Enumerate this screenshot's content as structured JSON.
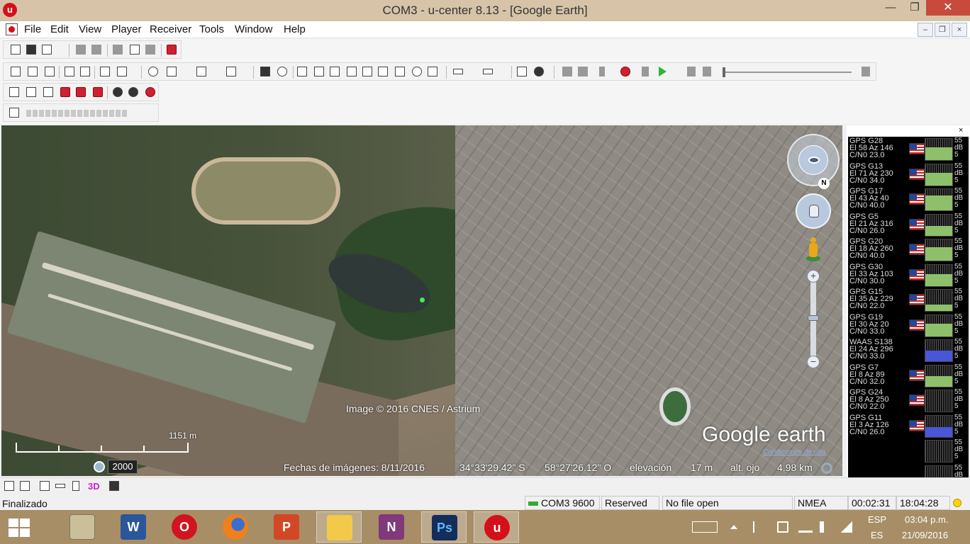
{
  "window": {
    "title": "COM3 - u-center 8.13 - [Google Earth]",
    "app_icon_letter": "u",
    "minimize_glyph": "—",
    "restore_glyph": "❐",
    "close_glyph": "✕"
  },
  "menu": {
    "items": [
      "File",
      "Edit",
      "View",
      "Player",
      "Receiver",
      "Tools",
      "Window",
      "Help"
    ],
    "mdi_min": "–",
    "mdi_restore": "❐",
    "mdi_close": "×"
  },
  "map": {
    "attribution": "Image © 2016 CNES / Astrium",
    "logo_google": "Google",
    "logo_earth": "earth",
    "terms": "Condiciones de uso",
    "scale_label": "1151 m",
    "history_year": "2000",
    "imagery_date": "Fechas de imágenes: 8/11/2016",
    "latitude": "34°33'29.42\" S",
    "longitude": "58°27'26.12\" O",
    "elevation_label": "elevación",
    "elevation_value": "17 m",
    "eye_alt_label": "alt. ojo",
    "eye_alt_value": "4.98 km",
    "north_label": "N",
    "zoom_in": "+",
    "zoom_out": "−"
  },
  "satellites": [
    {
      "name": "GPS G28",
      "el": "El 58 Az 146",
      "cn0": "C/N0 23.0",
      "level": 0.6,
      "flag": "us-flag-icon",
      "color": "#8ec06c"
    },
    {
      "name": "GPS G13",
      "el": "El 71 Az 230",
      "cn0": "C/N0 34.0",
      "level": 0.6,
      "flag": "us-flag-icon",
      "color": "#8ec06c"
    },
    {
      "name": "GPS G17",
      "el": "El 43 Az 40",
      "cn0": "C/N0 40.0",
      "level": 0.7,
      "flag": "us-flag-icon",
      "color": "#8ec06c"
    },
    {
      "name": "GPS G5",
      "el": "El 21 Az 316",
      "cn0": "C/N0 26.0",
      "level": 0.45,
      "flag": "us-flag-icon",
      "color": "#8ec06c"
    },
    {
      "name": "GPS G20",
      "el": "El 18 Az 260",
      "cn0": "C/N0 40.0",
      "level": 0.65,
      "flag": "us-flag-icon",
      "color": "#8ec06c"
    },
    {
      "name": "GPS G30",
      "el": "El 33 Az 103",
      "cn0": "C/N0 30.0",
      "level": 0.55,
      "flag": "us-flag-icon",
      "color": "#8ec06c"
    },
    {
      "name": "GPS G15",
      "el": "El 35 Az 229",
      "cn0": "C/N0 22.0",
      "level": 0.3,
      "flag": "us-flag-icon",
      "color": "#8ec06c"
    },
    {
      "name": "GPS G19",
      "el": "El 30 Az 20",
      "cn0": "C/N0 33.0",
      "level": 0.6,
      "flag": "us-flag-icon",
      "color": "#8ec06c"
    },
    {
      "name": "WAAS S138",
      "el": "El 24 Az 296",
      "cn0": "C/N0 33.0",
      "level": 0.5,
      "flag": "",
      "color": "#4a56d8"
    },
    {
      "name": "GPS G7",
      "el": "El 8 Az 89",
      "cn0": "C/N0 32.0",
      "level": 0.5,
      "flag": "us-flag-icon",
      "color": "#8ec06c"
    },
    {
      "name": "GPS G24",
      "el": "El 8 Az 250",
      "cn0": "C/N0 22.0",
      "level": 0.0,
      "flag": "us-flag-icon",
      "color": "#8ec06c"
    },
    {
      "name": "GPS G11",
      "el": "El 3 Az 126",
      "cn0": "C/N0 26.0",
      "level": 0.45,
      "flag": "us-flag-icon",
      "color": "#4a56d8"
    },
    {
      "name": "",
      "el": "",
      "cn0": "",
      "level": 0.0,
      "flag": "",
      "color": "#8ec06c"
    },
    {
      "name": "",
      "el": "",
      "cn0": "",
      "level": 0.0,
      "flag": "",
      "color": "#8ec06c"
    }
  ],
  "sat_scale": "55\ndB\n5",
  "sat_panel_close": "×",
  "bottom_tools": {
    "label_3d": "3D"
  },
  "status": {
    "text": "Finalizado",
    "port": "COM3 9600",
    "reserved": "Reserved",
    "file": "No file open",
    "protocol": "NMEA",
    "elapsed": "00:02:31",
    "clock": "18:04:28"
  },
  "taskbar": {
    "apps": [
      "Fixer",
      "Word",
      "Opera",
      "Firefox",
      "PowerPoint",
      "File Explorer",
      "OneNote",
      "Photoshop",
      "u-center"
    ],
    "word_letter": "W",
    "opera_letter": "O",
    "ppt_letter": "P",
    "onenote_letter": "N",
    "ps_letter": "Ps",
    "ucenter_letter": "u",
    "language": "ESP",
    "layout": "ES",
    "time": "03:04 p.m.",
    "date": "21/09/2016"
  }
}
